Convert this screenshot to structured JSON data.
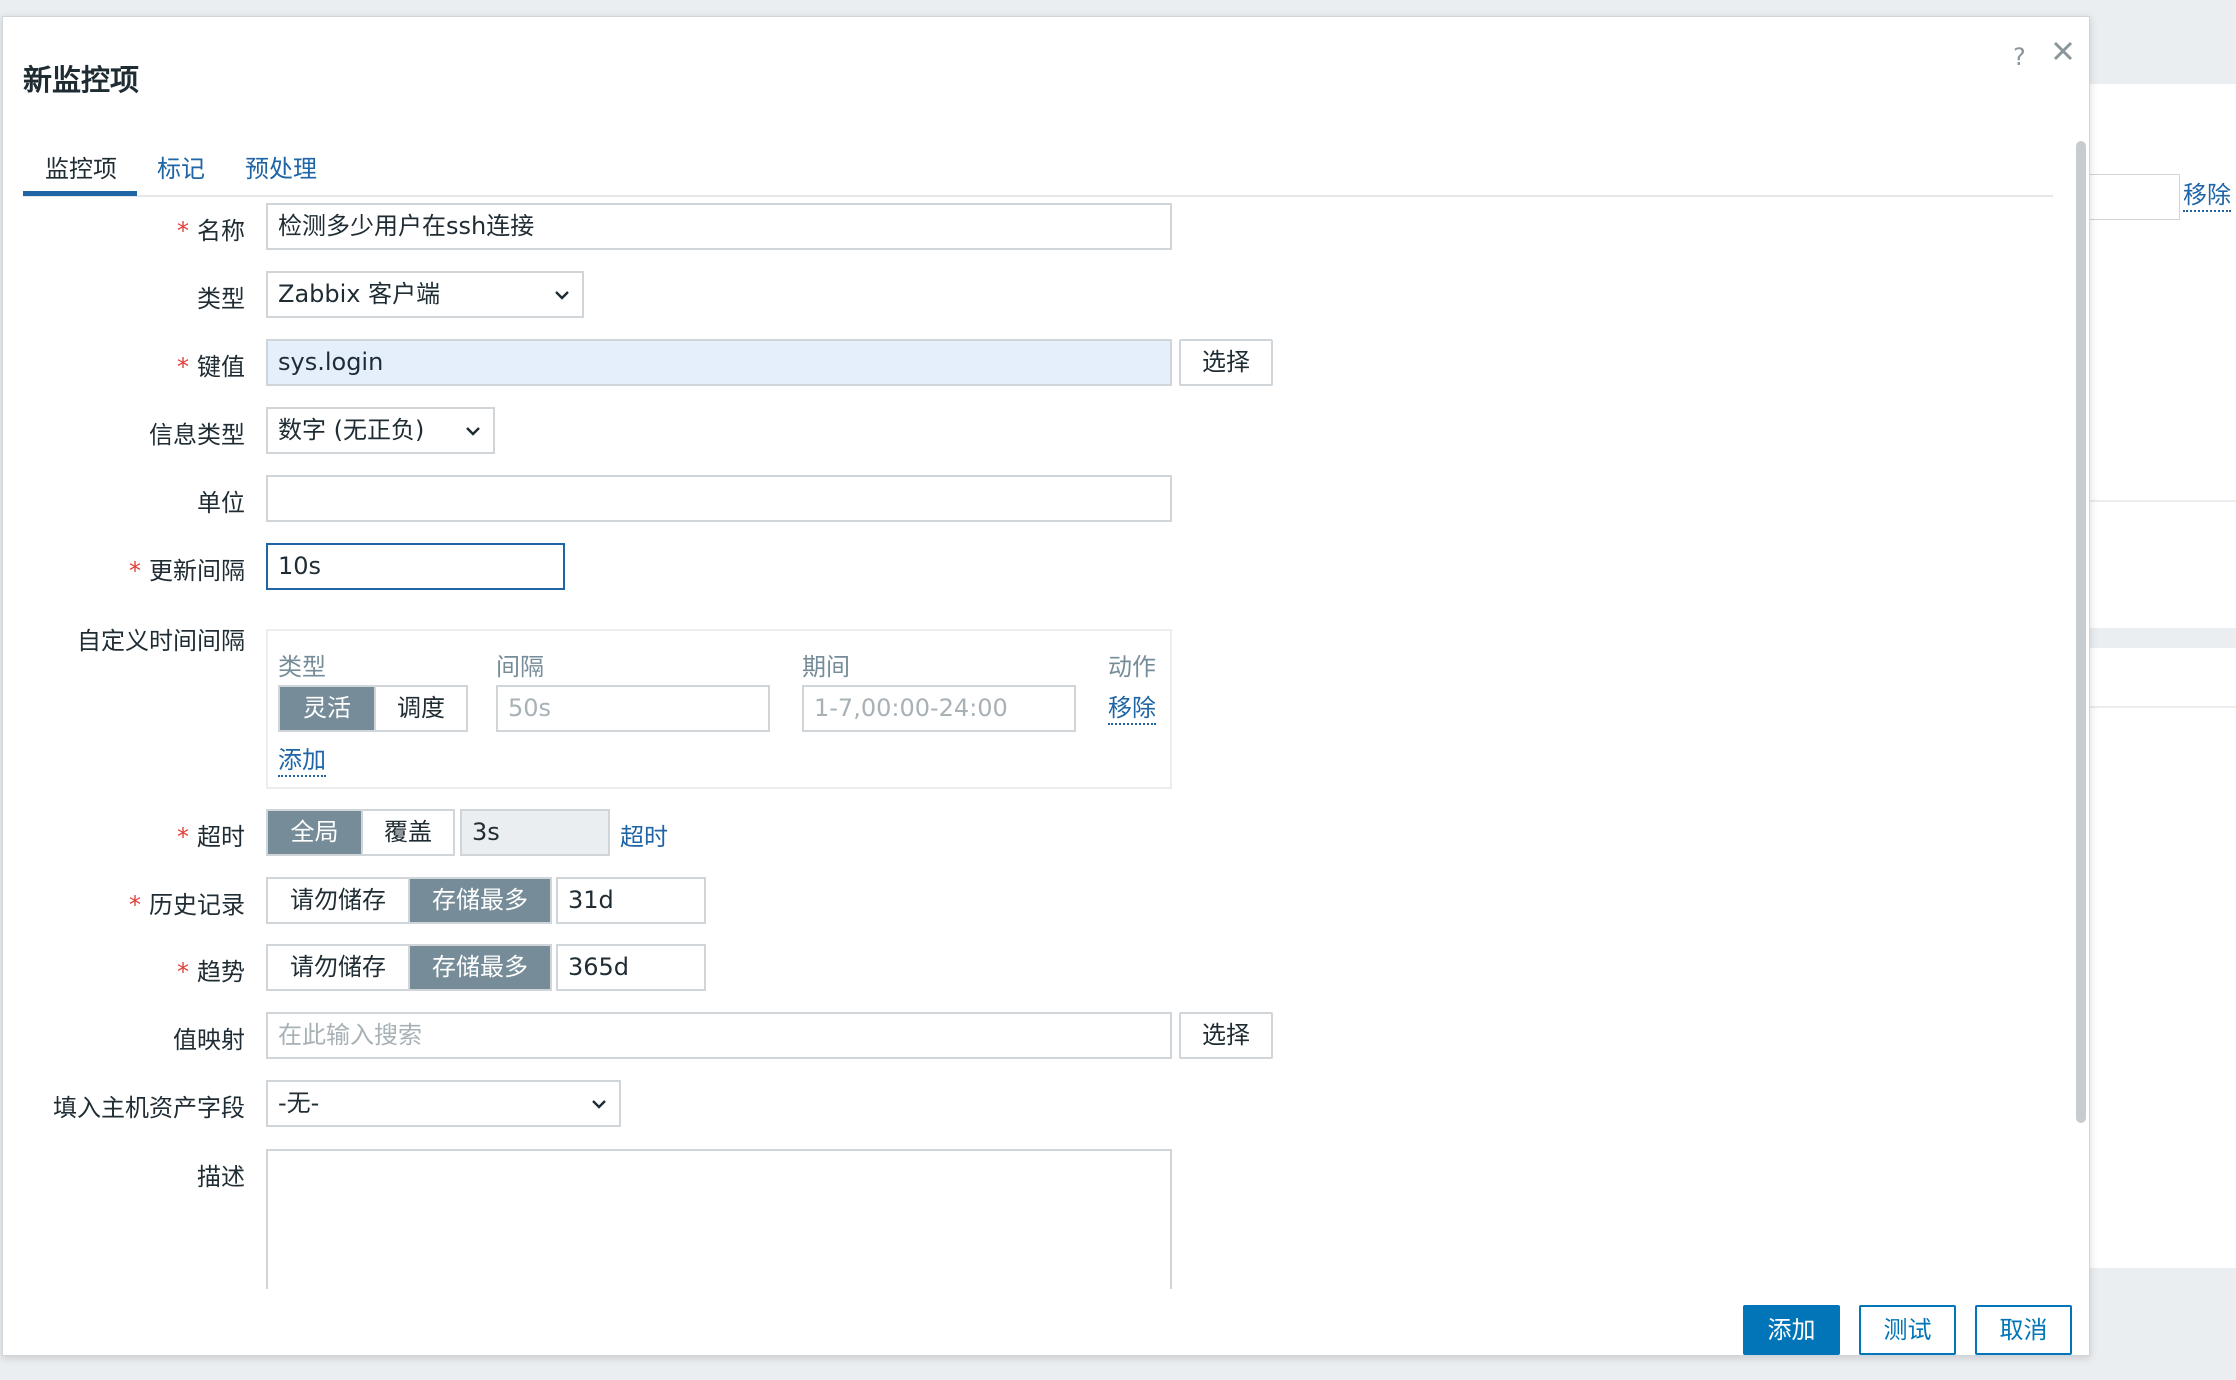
{
  "background": {
    "remove_link": "移除"
  },
  "modal": {
    "title": "新监控项",
    "help_icon": "?",
    "tabs": [
      {
        "label": "监控项",
        "active": true
      },
      {
        "label": "标记",
        "active": false
      },
      {
        "label": "预处理",
        "active": false
      }
    ]
  },
  "form": {
    "name": {
      "label": "名称",
      "required": true,
      "value": "检测多少用户在ssh连接"
    },
    "type": {
      "label": "类型",
      "value": "Zabbix 客户端"
    },
    "key": {
      "label": "键值",
      "required": true,
      "value": "sys.login",
      "select_button": "选择"
    },
    "info_type": {
      "label": "信息类型",
      "value": "数字 (无正负)"
    },
    "units": {
      "label": "单位",
      "value": ""
    },
    "update_interval": {
      "label": "更新间隔",
      "required": true,
      "value": "10s"
    },
    "custom_intervals": {
      "label": "自定义时间间隔",
      "headers": {
        "type": "类型",
        "interval": "间隔",
        "period": "期间",
        "action": "动作"
      },
      "row": {
        "type_options": [
          "灵活",
          "调度"
        ],
        "type_selected": "灵活",
        "interval_placeholder": "50s",
        "period_placeholder": "1-7,00:00-24:00",
        "remove_link": "移除"
      },
      "add_link": "添加"
    },
    "timeout": {
      "label": "超时",
      "required": true,
      "options": [
        "全局",
        "覆盖"
      ],
      "selected": "全局",
      "value": "3s",
      "link": "超时"
    },
    "history": {
      "label": "历史记录",
      "required": true,
      "options": [
        "请勿储存",
        "存储最多"
      ],
      "selected": "存储最多",
      "value": "31d"
    },
    "trends": {
      "label": "趋势",
      "required": true,
      "options": [
        "请勿储存",
        "存储最多"
      ],
      "selected": "存储最多",
      "value": "365d"
    },
    "value_map": {
      "label": "值映射",
      "placeholder": "在此输入搜索",
      "select_button": "选择"
    },
    "inventory": {
      "label": "填入主机资产字段",
      "value": "-无-"
    },
    "description": {
      "label": "描述",
      "value": ""
    }
  },
  "footer": {
    "add": "添加",
    "test": "测试",
    "cancel": "取消"
  },
  "colors": {
    "accent": "#0275b8",
    "link": "#1f65a6",
    "segment_active": "#768d99",
    "required": "#e0403a"
  }
}
